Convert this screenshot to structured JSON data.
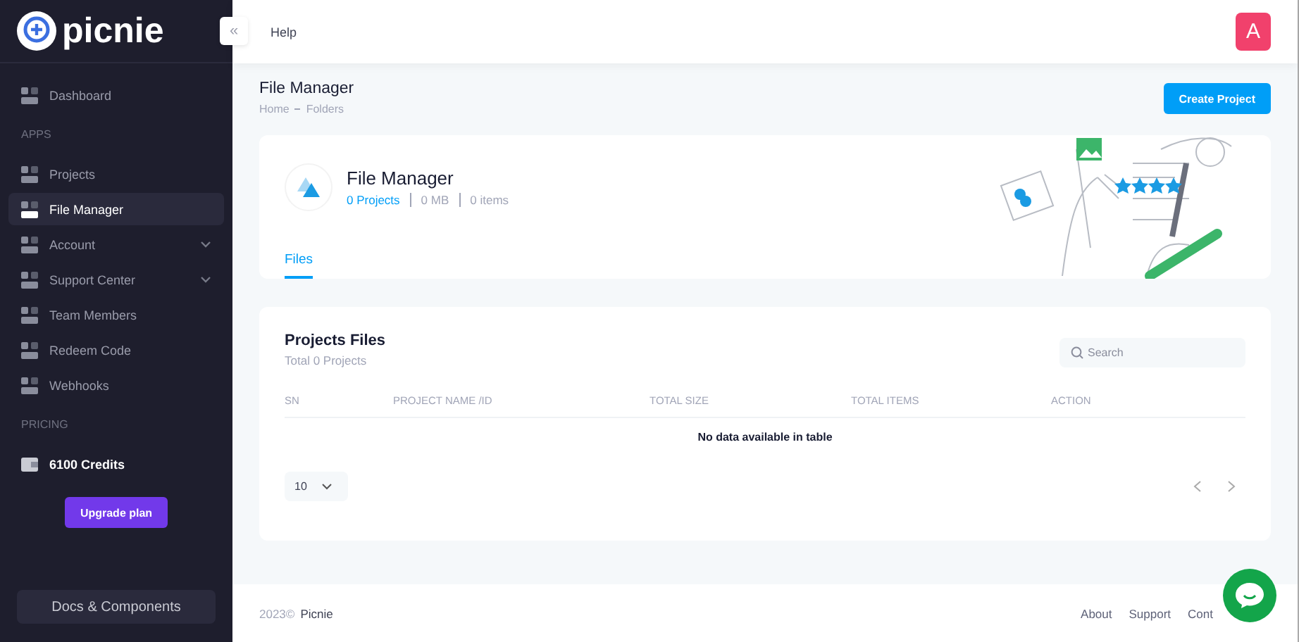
{
  "sidebar": {
    "logo": "picnie",
    "items": [
      {
        "kind": "item",
        "label": "Dashboard",
        "selected": false,
        "expandable": false
      },
      {
        "kind": "section",
        "label": "APPS"
      },
      {
        "kind": "item",
        "label": "Projects",
        "selected": false,
        "expandable": false
      },
      {
        "kind": "item",
        "label": "File Manager",
        "selected": true,
        "expandable": false
      },
      {
        "kind": "item",
        "label": "Account",
        "selected": false,
        "expandable": true
      },
      {
        "kind": "item",
        "label": "Support Center",
        "selected": false,
        "expandable": true
      },
      {
        "kind": "item",
        "label": "Team Members",
        "selected": false,
        "expandable": false
      },
      {
        "kind": "item",
        "label": "Redeem Code",
        "selected": false,
        "expandable": false
      },
      {
        "kind": "item",
        "label": "Webhooks",
        "selected": false,
        "expandable": false
      },
      {
        "kind": "section",
        "label": "PRICING"
      },
      {
        "kind": "credits",
        "label": "6100 Credits"
      }
    ],
    "upgrade_button": "Upgrade plan",
    "docs_button": "Docs & Components"
  },
  "header": {
    "collapse": "«",
    "help": "Help",
    "avatar": "A"
  },
  "page": {
    "title": "File Manager",
    "breadcrumb": [
      "Home",
      "Folders"
    ],
    "create_button": "Create Project"
  },
  "summary": {
    "title": "File Manager",
    "stats": [
      {
        "text": "0 Projects",
        "link": true
      },
      {
        "text": "0 MB",
        "link": false
      },
      {
        "text": "0 items",
        "link": false
      }
    ],
    "tabs": [
      {
        "label": "Files",
        "selected": true
      }
    ]
  },
  "table_card": {
    "title": "Projects Files",
    "subtitle": "Total 0 Projects",
    "search": {
      "placeholder": "Search"
    },
    "columns": [
      "SN",
      "PROJECT NAME /ID",
      "TOTAL SIZE",
      "TOTAL ITEMS",
      "ACTION"
    ],
    "empty": "No data available in table",
    "page_size": "10"
  },
  "footer": {
    "year": "2023©",
    "brand": "Picnie",
    "links": [
      "About",
      "Support",
      "Cont"
    ]
  }
}
